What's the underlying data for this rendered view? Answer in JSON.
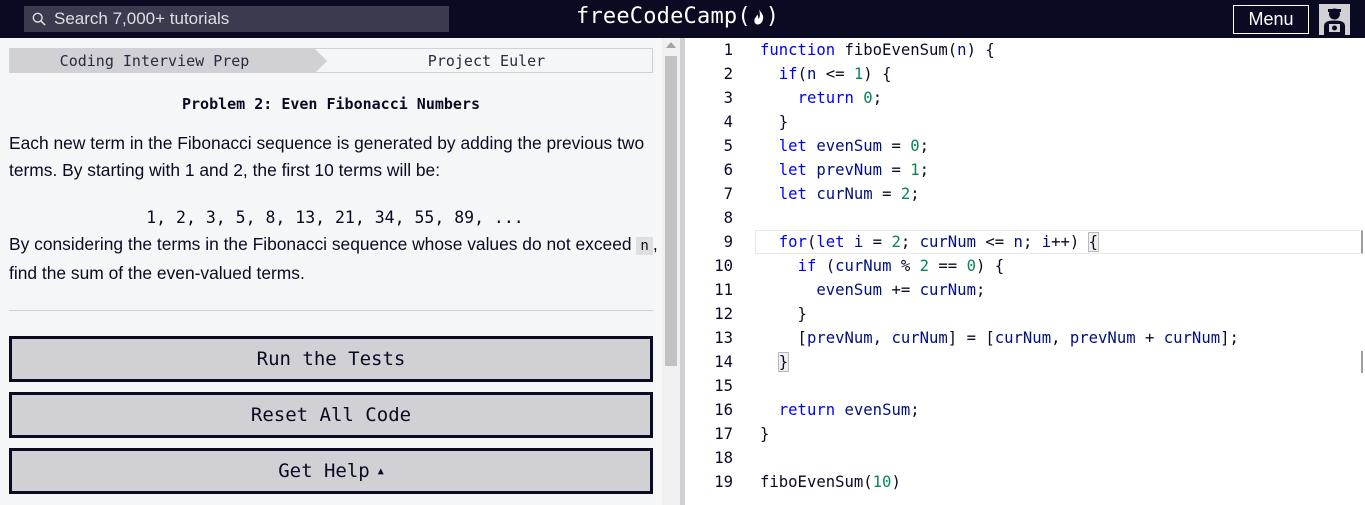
{
  "nav": {
    "search_placeholder": "Search 7,000+ tutorials",
    "logo_text": "freeCodeCamp(",
    "logo_text_end": ")",
    "menu_label": "Menu"
  },
  "breadcrumb": {
    "parent": "Coding Interview Prep",
    "current": "Project Euler"
  },
  "challenge": {
    "title": "Problem 2: Even Fibonacci Numbers",
    "description_1": "Each new term in the Fibonacci sequence is generated by adding the previous two terms. By starting with 1 and 2, the first 10 terms will be:",
    "sequence": "1, 2, 3, 5, 8, 13, 21, 34, 55, 89, ...",
    "description_2_pre": "By considering the terms in the Fibonacci sequence whose values do not exceed ",
    "description_2_code": "n",
    "description_2_post": ", find the sum of the even-valued terms."
  },
  "actions": {
    "run_tests": "Run the Tests",
    "reset_code": "Reset All Code",
    "get_help": "Get Help",
    "get_help_caret": "▲"
  },
  "editor": {
    "active_line": 9,
    "lines": [
      {
        "n": "1"
      },
      {
        "n": "2"
      },
      {
        "n": "3"
      },
      {
        "n": "4"
      },
      {
        "n": "5"
      },
      {
        "n": "6"
      },
      {
        "n": "7"
      },
      {
        "n": "8"
      },
      {
        "n": "9"
      },
      {
        "n": "10"
      },
      {
        "n": "11"
      },
      {
        "n": "12"
      },
      {
        "n": "13"
      },
      {
        "n": "14"
      },
      {
        "n": "15"
      },
      {
        "n": "16"
      },
      {
        "n": "17"
      },
      {
        "n": "18"
      },
      {
        "n": "19"
      }
    ],
    "tokens": {
      "function": "function",
      "fiboEvenSum": "fiboEvenSum",
      "n": "n",
      "if": "if",
      "return": "return",
      "let": "let",
      "for": "for",
      "evenSum": "evenSum",
      "prevNum": "prevNum",
      "curNum": "curNum",
      "i": "i",
      "zero": "0",
      "one": "1",
      "two": "2",
      "ten": "10"
    }
  },
  "colors": {
    "nav_bg": "#0a0a23",
    "keyword": "#0000ff",
    "number": "#098658",
    "variable": "#001080",
    "button_bg": "#d0d0d5"
  }
}
